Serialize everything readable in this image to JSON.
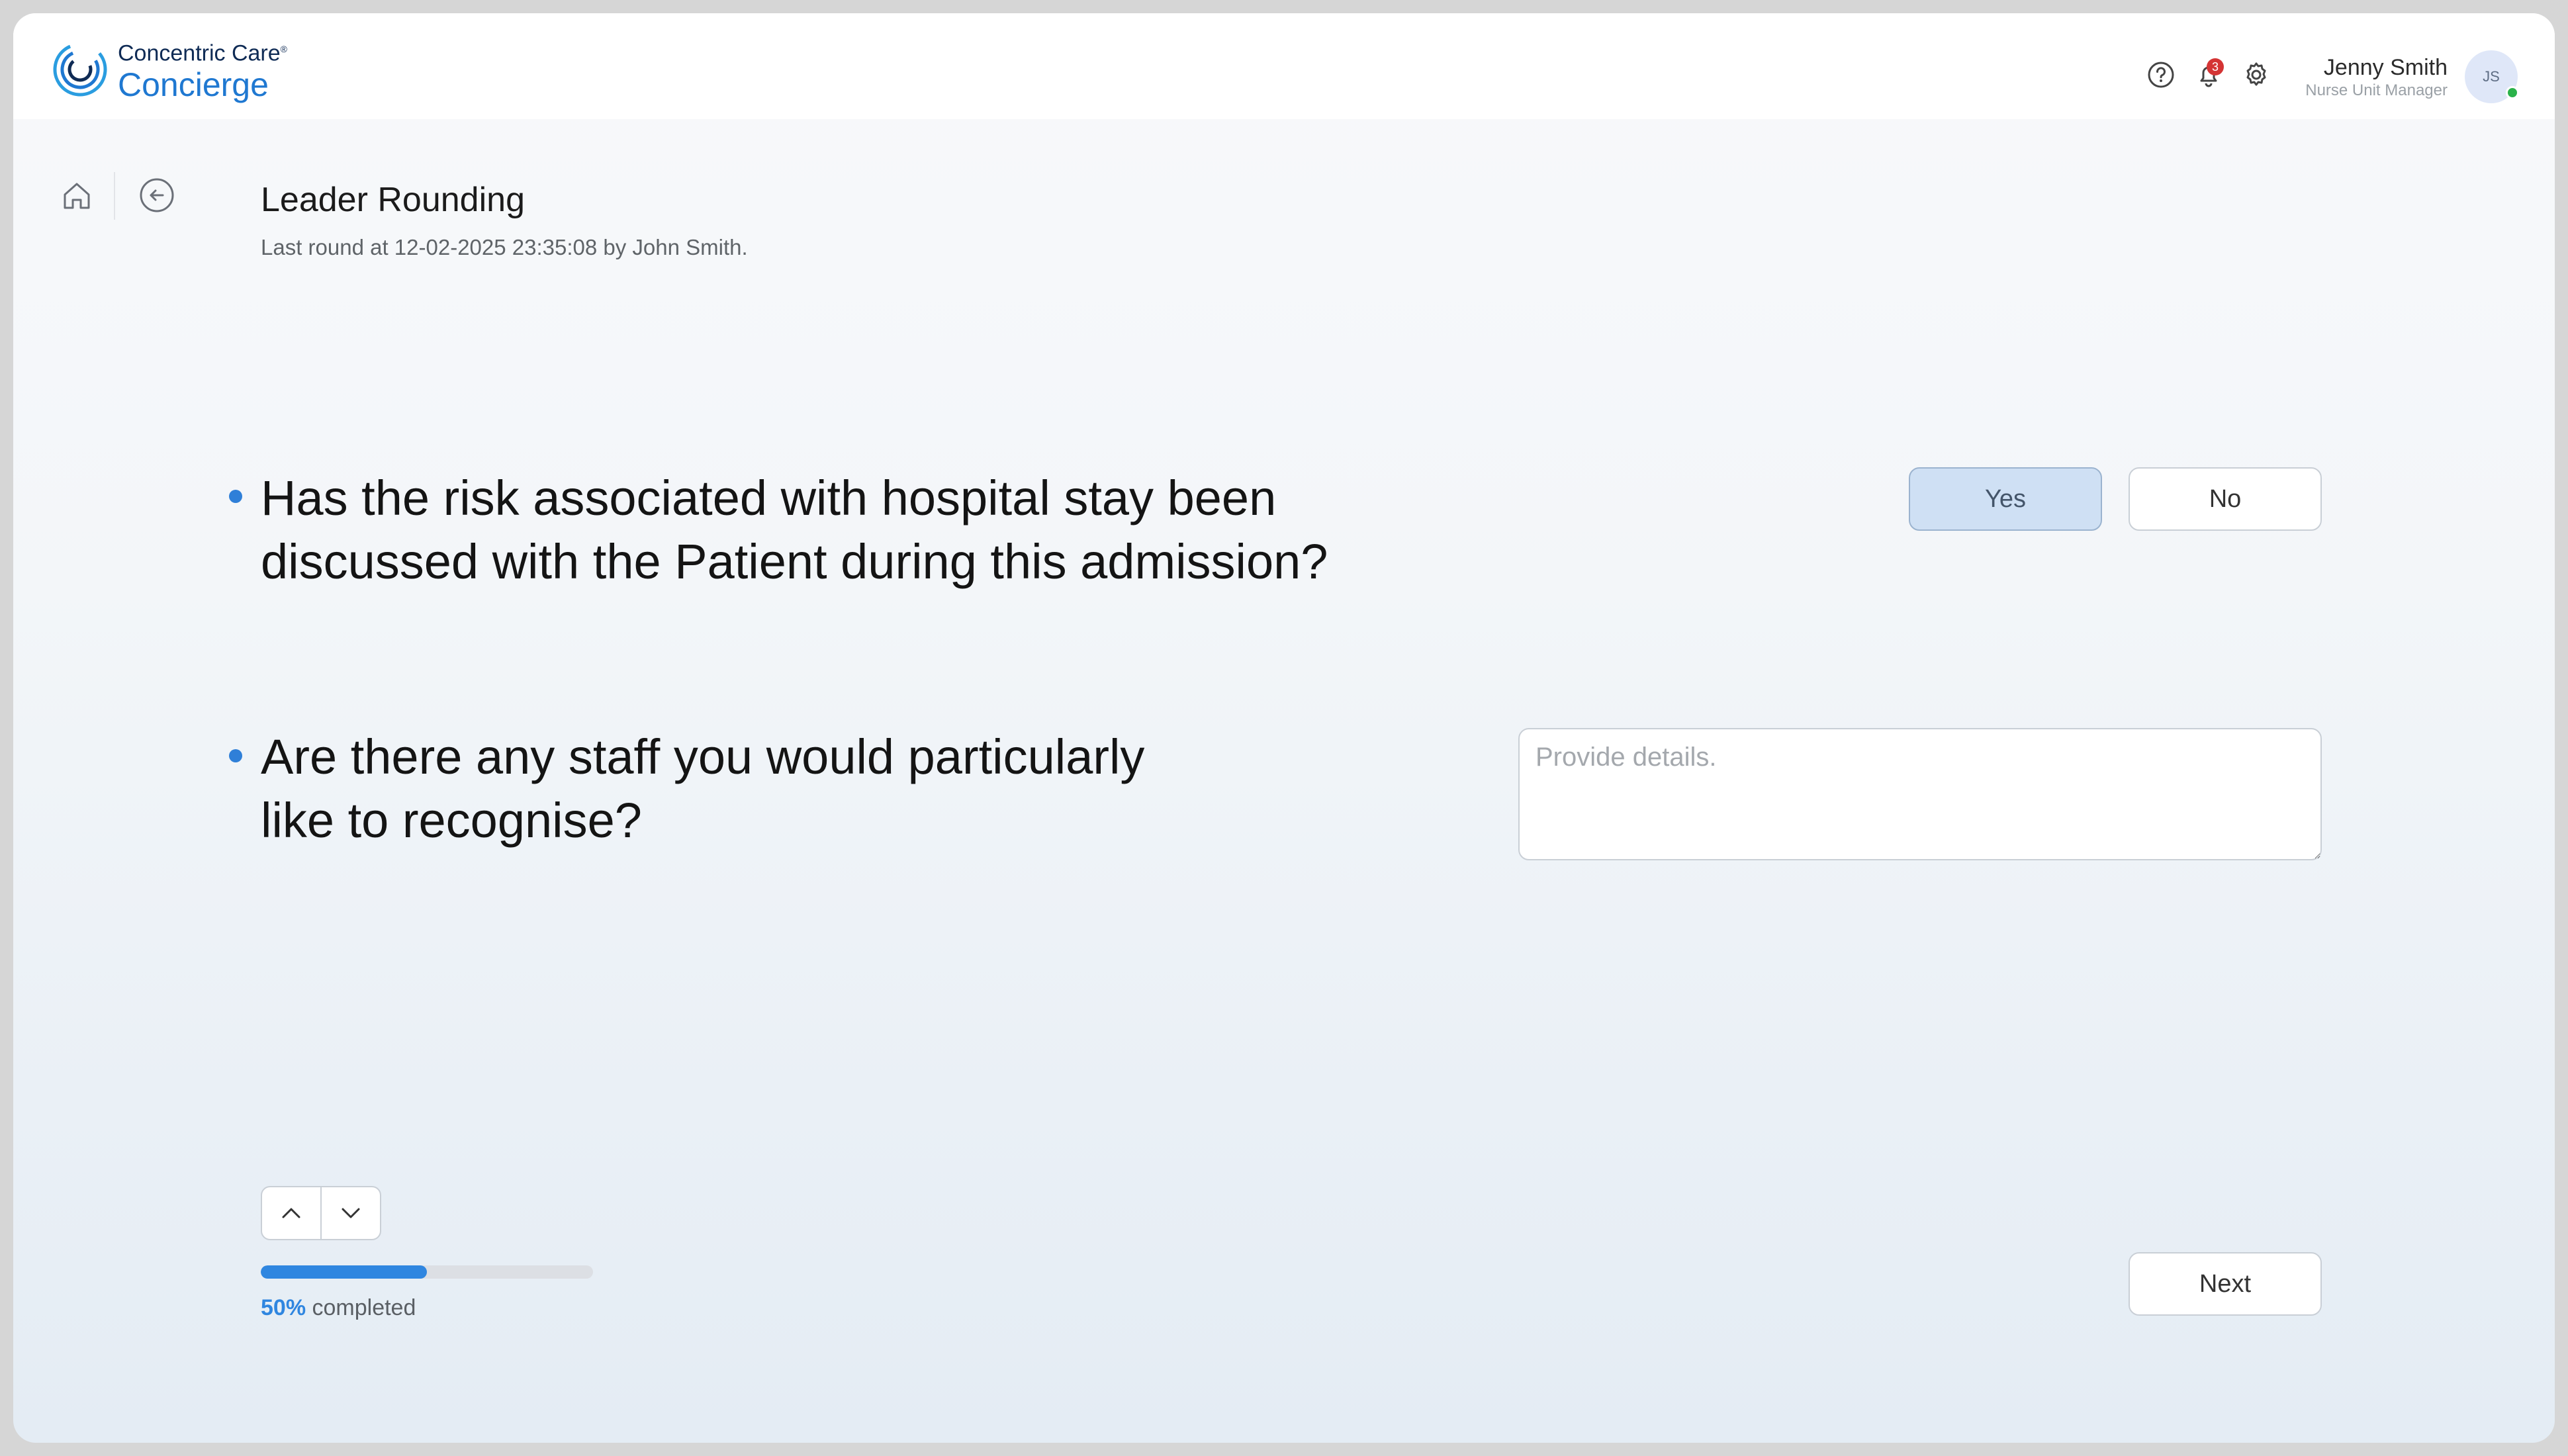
{
  "brand": {
    "line1": "Concentric Care",
    "trademark": "®",
    "line2": "Concierge",
    "colors": {
      "primary": "#1f78d1",
      "dark": "#0f2b55"
    }
  },
  "header": {
    "icons": [
      "help-icon",
      "bell-icon",
      "gear-icon"
    ],
    "notification_count": "3",
    "user": {
      "name": "Jenny Smith",
      "role": "Nurse Unit Manager",
      "initials": "JS",
      "status": "online"
    }
  },
  "breadcrumb": {
    "icons": [
      "home-icon",
      "back-arrow-icon"
    ]
  },
  "page": {
    "title": "Leader Rounding",
    "subtitle": "Last round at 12-02-2025 23:35:08 by John Smith."
  },
  "questions": [
    {
      "line1": "Has the risk associated with hospital stay been",
      "line2": "discussed with the Patient during this admission?",
      "options": {
        "yes": "Yes",
        "no": "No"
      },
      "selected": "Yes"
    },
    {
      "line1": "Are there any staff you would particularly",
      "line2": "like to recognise?",
      "placeholder": "Provide details.",
      "value": ""
    }
  ],
  "progress": {
    "percent": 50,
    "percent_label": "50%",
    "suffix": " completed"
  },
  "footer": {
    "next_label": "Next"
  }
}
